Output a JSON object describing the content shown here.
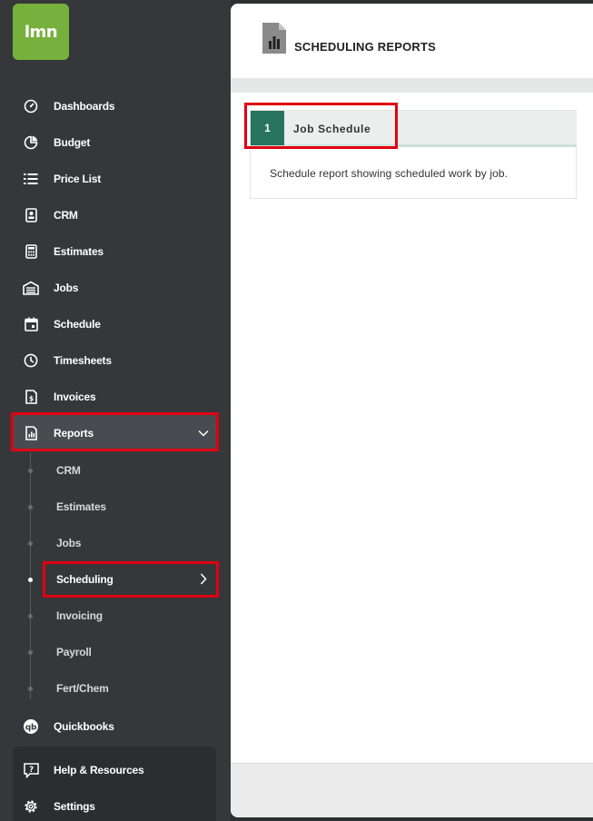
{
  "brand": {
    "logo_text": "lmn",
    "accent": "#77b13d"
  },
  "sidebar": {
    "items": [
      {
        "label": "Dashboards",
        "icon": "dashboard-gauge-icon"
      },
      {
        "label": "Budget",
        "icon": "pie-chart-icon"
      },
      {
        "label": "Price List",
        "icon": "list-icon"
      },
      {
        "label": "CRM",
        "icon": "contact-card-icon"
      },
      {
        "label": "Estimates",
        "icon": "calculator-icon"
      },
      {
        "label": "Jobs",
        "icon": "garage-icon"
      },
      {
        "label": "Schedule",
        "icon": "calendar-icon"
      },
      {
        "label": "Timesheets",
        "icon": "clock-icon"
      },
      {
        "label": "Invoices",
        "icon": "invoice-icon"
      },
      {
        "label": "Reports",
        "icon": "report-icon",
        "expanded": true
      }
    ],
    "reports_sub": [
      {
        "label": "CRM"
      },
      {
        "label": "Estimates"
      },
      {
        "label": "Jobs"
      },
      {
        "label": "Scheduling",
        "active": true
      },
      {
        "label": "Invoicing"
      },
      {
        "label": "Payroll"
      },
      {
        "label": "Fert/Chem"
      }
    ],
    "bottom_items": [
      {
        "label": "Quickbooks",
        "icon": "quickbooks-icon"
      },
      {
        "label": "Help & Resources",
        "icon": "help-icon"
      },
      {
        "label": "Settings",
        "icon": "gear-icon"
      }
    ]
  },
  "main": {
    "title": "SCHEDULING REPORTS",
    "reports": [
      {
        "number": "1",
        "name": "Job Schedule",
        "description": "Schedule report showing scheduled work by job."
      }
    ]
  },
  "colors": {
    "highlight": "#e00010",
    "badge": "#27735c"
  }
}
